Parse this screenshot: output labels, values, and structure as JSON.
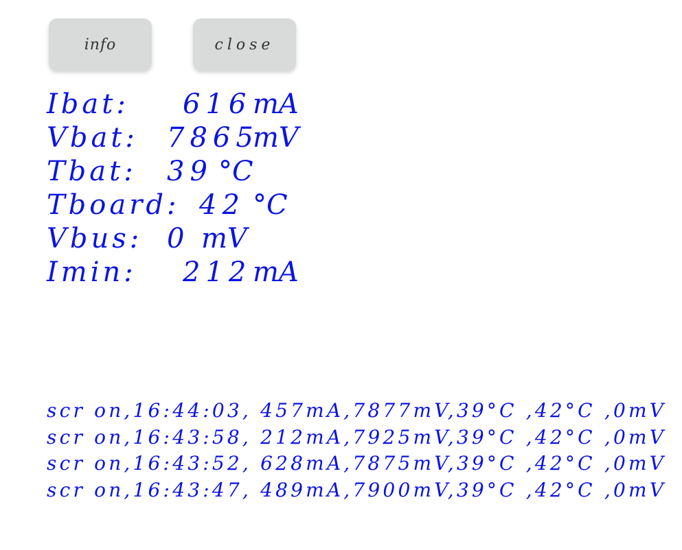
{
  "buttons": {
    "info_label": "info",
    "close_label": "close"
  },
  "stats": [
    {
      "label": "Ibat:",
      "value": "616",
      "unit": "mA"
    },
    {
      "label": "Vbat:",
      "value": "7865",
      "unit": "mV"
    },
    {
      "label": "Tbat:",
      "value": "39",
      "unit": "°C"
    },
    {
      "label": "Tboard:",
      "value": "42",
      "unit": "°C"
    },
    {
      "label": "Vbus:",
      "value": "0",
      "unit": "mV"
    },
    {
      "label": "Imin:",
      "value": "212",
      "unit": "mA"
    }
  ],
  "log": [
    "scr on,16:44:03, 457mA,7877mV,39°C ,42°C ,0mV",
    "scr on,16:43:58, 212mA,7925mV,39°C ,42°C ,0mV",
    "scr on,16:43:52, 628mA,7875mV,39°C ,42°C ,0mV",
    "scr on,16:43:47, 489mA,7900mV,39°C ,42°C ,0mV"
  ],
  "colors": {
    "text_blue": "#0a14e0",
    "button_bg": "#d9dada"
  }
}
